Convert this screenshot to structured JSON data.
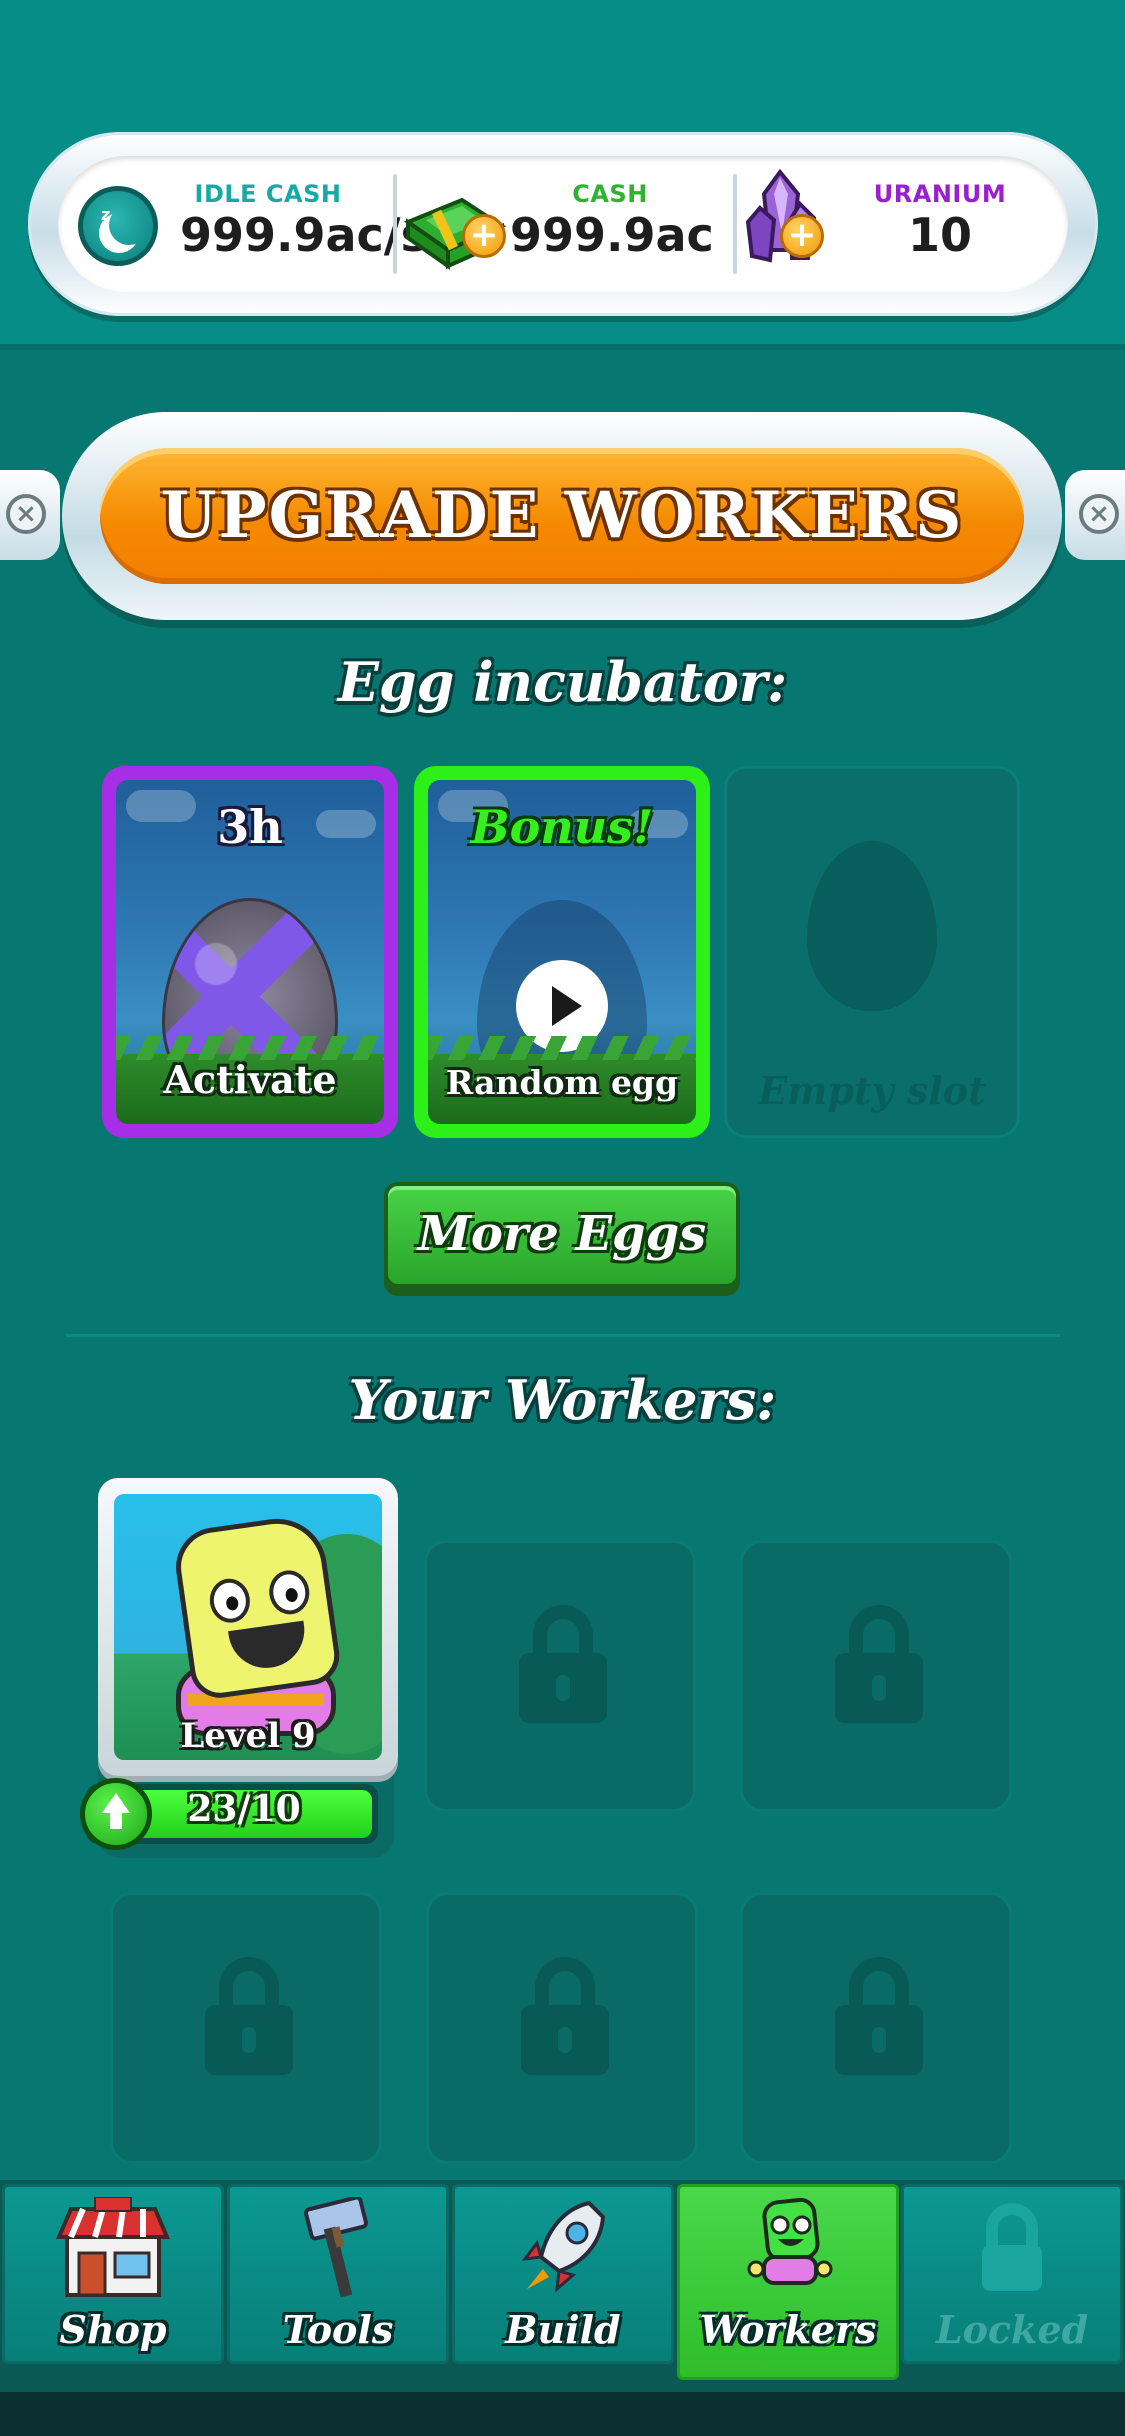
{
  "currency": {
    "idle_cash": {
      "label": "IDLE CASH",
      "value": "999.9ac/s",
      "color": "#17a9a3",
      "icon": "moon-icon"
    },
    "cash": {
      "label": "CASH",
      "value": "999.9ac",
      "color": "#2fb32f",
      "icon": "cash-stack-icon"
    },
    "uranium": {
      "label": "URANIUM",
      "value": "10",
      "color": "#9a1fcf",
      "icon": "crystal-icon"
    }
  },
  "title": "UPGRADE WORKERS",
  "incubator": {
    "heading": "Egg incubator:",
    "slots": [
      {
        "top": "3h",
        "bottom": "Activate",
        "icon": "purple-egg-icon"
      },
      {
        "top": "Bonus!",
        "bottom": "Random egg",
        "icon": "play-icon"
      },
      {
        "bottom": "Empty slot",
        "icon": "egg-silhouette-icon"
      }
    ],
    "more_button": "More Eggs"
  },
  "workers": {
    "heading": "Your Workers:",
    "card": {
      "level": "Level 9",
      "progress": "23/10",
      "progress_fraction": 1.0
    },
    "locked_slots": 5
  },
  "nav": {
    "tabs": [
      {
        "label": "Shop",
        "icon": "shop-icon"
      },
      {
        "label": "Tools",
        "icon": "hammer-icon"
      },
      {
        "label": "Build",
        "icon": "rocket-icon"
      },
      {
        "label": "Workers",
        "icon": "worker-icon",
        "active": true
      },
      {
        "label": "Locked",
        "icon": "lock-icon",
        "locked": true
      }
    ]
  }
}
